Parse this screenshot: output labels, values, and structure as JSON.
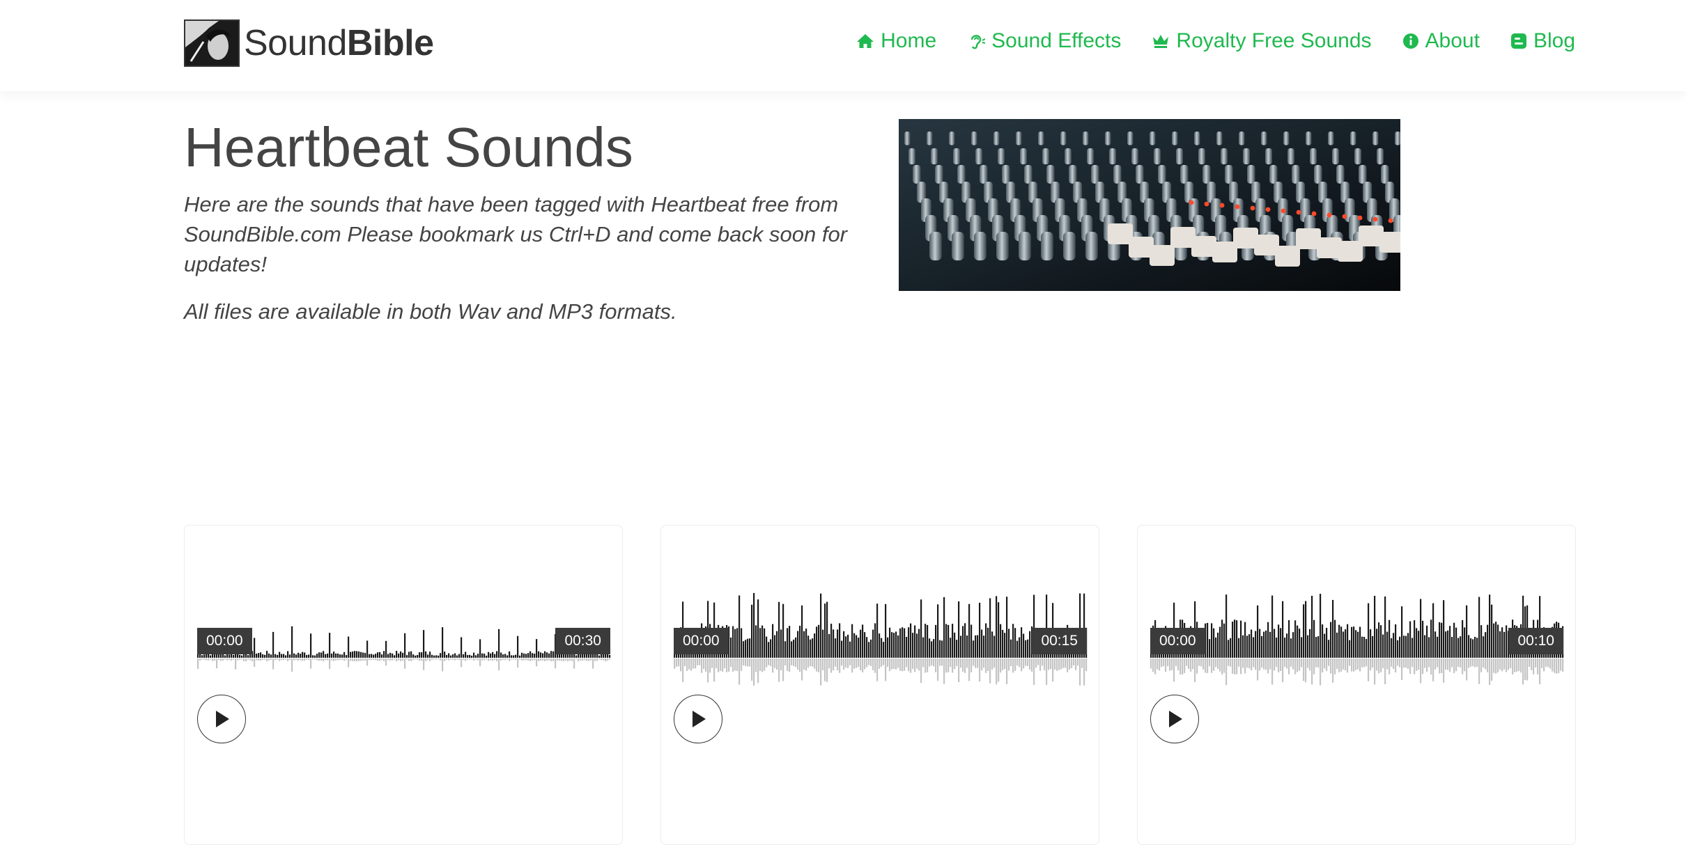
{
  "brand": {
    "text_light": "Sound",
    "text_bold": "Bible"
  },
  "nav": [
    {
      "label": "Home",
      "icon": "home-icon"
    },
    {
      "label": "Sound Effects",
      "icon": "ear-icon"
    },
    {
      "label": "Royalty Free Sounds",
      "icon": "crown-icon"
    },
    {
      "label": "About",
      "icon": "info-icon"
    },
    {
      "label": "Blog",
      "icon": "blogger-icon"
    }
  ],
  "hero": {
    "title": "Heartbeat Sounds",
    "description": "Here are the sounds that have been tagged with Heartbeat free from SoundBible.com Please bookmark us Ctrl+D and come back soon for updates!",
    "note": "All files are available in both Wav and MP3 formats."
  },
  "players": [
    {
      "start_time": "00:00",
      "end_time": "00:30",
      "progress": 0.13
    },
    {
      "start_time": "00:00",
      "end_time": "00:15",
      "progress": 0
    },
    {
      "start_time": "00:00",
      "end_time": "00:10",
      "progress": 0
    }
  ],
  "colors": {
    "accent": "#1fb94f",
    "text": "#444444",
    "wave_played": "#1a1a1a",
    "wave_reflection": "#c4c4c4"
  }
}
